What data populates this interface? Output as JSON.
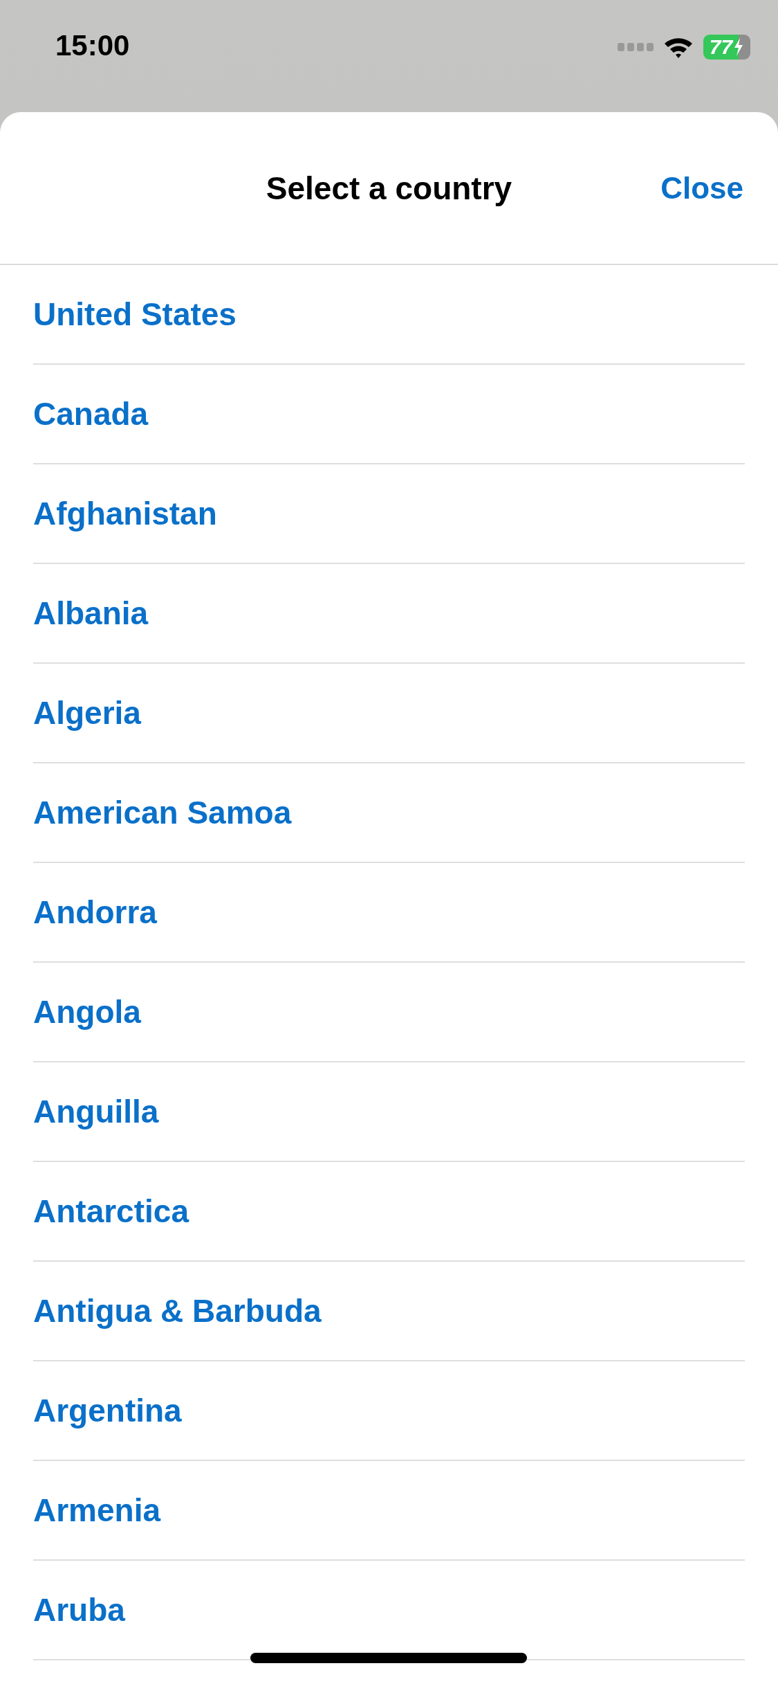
{
  "status_bar": {
    "time": "15:00",
    "battery": "77"
  },
  "sheet": {
    "title": "Select a country",
    "close": "Close"
  },
  "countries": [
    "United States",
    "Canada",
    "Afghanistan",
    "Albania",
    "Algeria",
    "American Samoa",
    "Andorra",
    "Angola",
    "Anguilla",
    "Antarctica",
    "Antigua & Barbuda",
    "Argentina",
    "Armenia",
    "Aruba"
  ]
}
